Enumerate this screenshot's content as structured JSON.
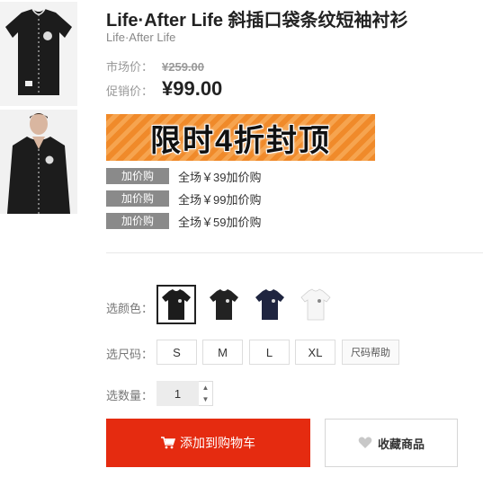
{
  "product": {
    "title": "Life·After Life 斜插口袋条纹短袖衬衫",
    "brand": "Life·After Life"
  },
  "price": {
    "market_label": "市场价：",
    "market_value": "¥259.00",
    "promo_label": "促销价：",
    "promo_value": "¥99.00"
  },
  "promo_banner": {
    "text": "限时4折封顶",
    "color": "#f08a2a"
  },
  "addons": [
    {
      "tag": "加价购",
      "text": "全场￥39加价购"
    },
    {
      "tag": "加价购",
      "text": "全场￥99加价购"
    },
    {
      "tag": "加价购",
      "text": "全场￥59加价购"
    }
  ],
  "options": {
    "color_label": "选颜色：",
    "color_swatches": [
      "black-shirt",
      "black-shirt-alt",
      "navy-shirt",
      "white-shirt"
    ],
    "size_label": "选尺码：",
    "sizes": [
      "S",
      "M",
      "L",
      "XL"
    ],
    "size_help": "尺码帮助",
    "qty_label": "选数量：",
    "qty_value": "1"
  },
  "actions": {
    "add_to_cart": "添加到购物车",
    "favorite": "收藏商品",
    "cart_color": "#e52b10"
  }
}
